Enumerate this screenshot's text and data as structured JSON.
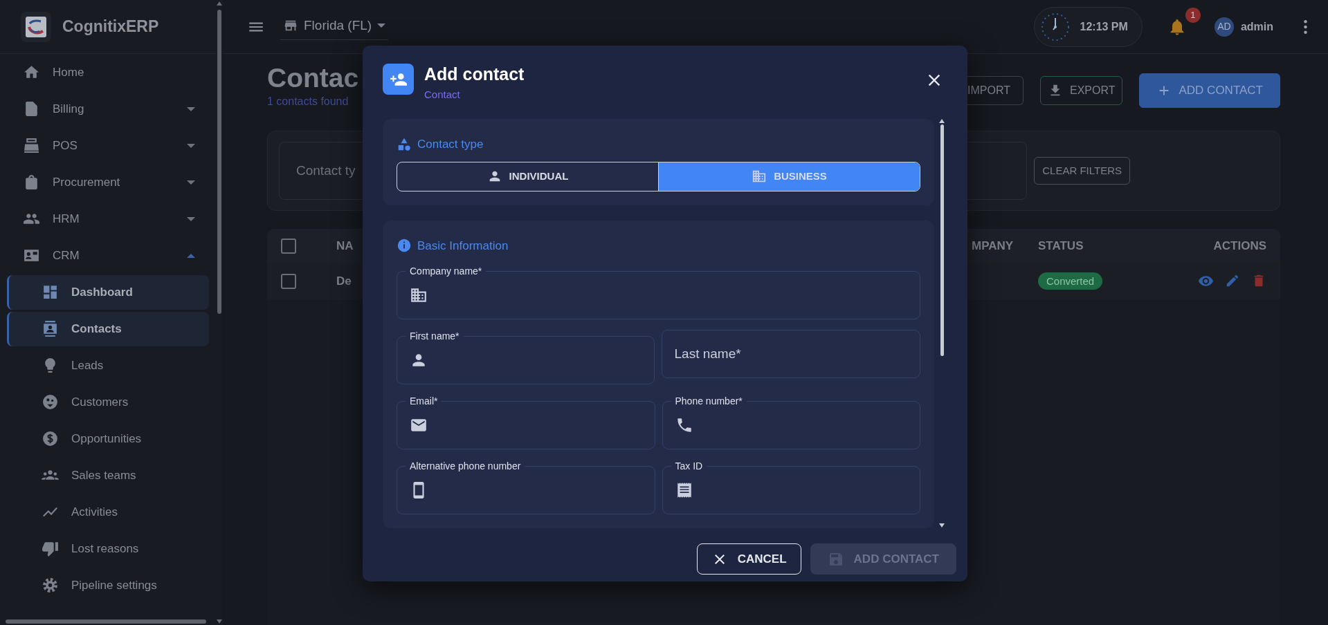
{
  "sidebar": {
    "brand": "CognitixERP",
    "items": [
      {
        "label": "Home"
      },
      {
        "label": "Billing",
        "expanded": false
      },
      {
        "label": "POS",
        "expanded": false
      },
      {
        "label": "Procurement",
        "expanded": false
      },
      {
        "label": "HRM",
        "expanded": false
      },
      {
        "label": "CRM",
        "expanded": true,
        "children": [
          {
            "label": "Dashboard",
            "selected": true
          },
          {
            "label": "Contacts",
            "selected": true
          },
          {
            "label": "Leads",
            "selected": false
          },
          {
            "label": "Customers",
            "selected": false
          },
          {
            "label": "Opportunities",
            "selected": false
          },
          {
            "label": "Sales teams",
            "selected": false
          },
          {
            "label": "Activities",
            "selected": false
          },
          {
            "label": "Lost reasons",
            "selected": false
          },
          {
            "label": "Pipeline settings",
            "selected": false
          }
        ]
      }
    ]
  },
  "topbar": {
    "location": "Florida (FL)",
    "time": "12:13 PM",
    "notification_count": "1",
    "avatar_initials": "AD",
    "user": "admin"
  },
  "page": {
    "title": "Contac",
    "subtitle": "1 contacts found",
    "header_buttons": [
      {
        "label": "IMPORT",
        "kind": "outline"
      },
      {
        "label": "EXPORT",
        "kind": "export"
      },
      {
        "label": "ADD CONTACT",
        "kind": "primary"
      }
    ],
    "filters": {
      "placeholder": "Contact ty",
      "clear_label": "CLEAR FILTERS"
    },
    "table": {
      "columns": [
        "NA",
        "MPANY",
        "STATUS",
        "ACTIONS"
      ],
      "header_checked": false,
      "rows": [
        {
          "name": "De",
          "status": "Converted",
          "checked": false
        }
      ]
    }
  },
  "modal": {
    "title": "Add contact",
    "subtitle": "Contact",
    "contact_type": {
      "title": "Contact type",
      "options": [
        {
          "label": "INDIVIDUAL",
          "selected": false
        },
        {
          "label": "BUSINESS",
          "selected": true
        }
      ]
    },
    "basic_info": {
      "title": "Basic Information",
      "rows": [
        [
          {
            "kind": "company",
            "label": "Company name*"
          }
        ],
        [
          {
            "kind": "person",
            "label": "First name*"
          },
          {
            "kind": "text",
            "placeholder": "Last name*"
          }
        ],
        [
          {
            "kind": "email",
            "label": "Email*"
          },
          {
            "kind": "phone",
            "label": "Phone number*"
          }
        ],
        [
          {
            "kind": "mobile",
            "label": "Alternative phone number"
          },
          {
            "kind": "tax",
            "label": "Tax ID"
          }
        ]
      ]
    },
    "buttons": [
      {
        "label": "CANCEL",
        "kind": "cancel",
        "disabled": false
      },
      {
        "label": "ADD CONTACT",
        "kind": "save",
        "disabled": true
      }
    ]
  }
}
